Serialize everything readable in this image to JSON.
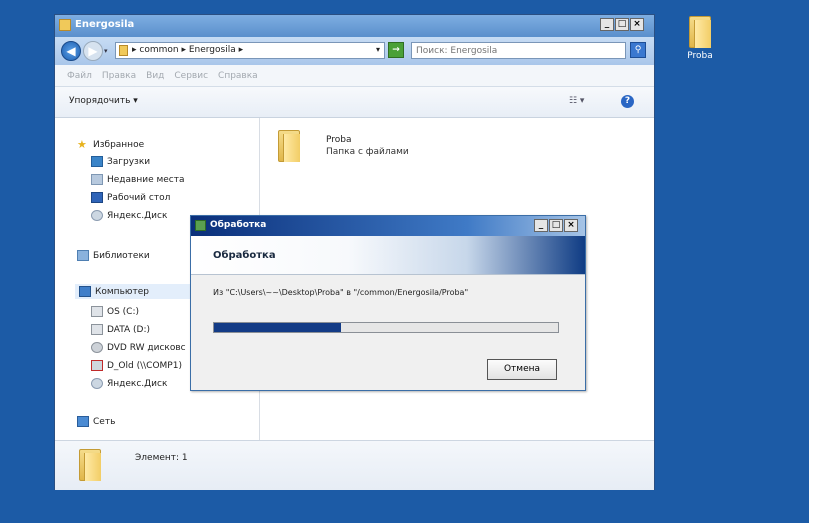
{
  "desktop": {
    "icon_label": "Proba",
    "colors": {
      "background": "#1c5ba6"
    }
  },
  "explorer": {
    "title": "Energosila",
    "window_buttons": {
      "minimize": "_",
      "maximize": "□",
      "close": "×"
    },
    "nav": {
      "back": "◀",
      "forward": "▶",
      "history": "▾"
    },
    "breadcrumb": "▸ common ▸ Energosila ▸",
    "address_dropdown": "▾",
    "refresh": "→",
    "search_placeholder": "Поиск: Energosila",
    "search_button": "⚲",
    "menu": [
      "Файл",
      "Правка",
      "Вид",
      "Сервис",
      "Справка"
    ],
    "toolbar": {
      "organize": "Упорядочить ▾",
      "view": "☷ ▾",
      "help": "?"
    },
    "sidebar": {
      "favorites": "Избранное",
      "fav_items": [
        "Загрузки",
        "Недавние места",
        "Рабочий стол",
        "Яндекс.Диск"
      ],
      "libraries": "Библиотеки",
      "computer": "Компьютер",
      "drives": [
        "OS (C:)",
        "DATA (D:)",
        "DVD RW дисковс",
        "D_Old (\\\\COMP1)",
        "Яндекс.Диск"
      ],
      "network": "Сеть"
    },
    "content": {
      "folder_name": "Proba",
      "folder_type": "Папка с файлами"
    },
    "details": "Элемент: 1"
  },
  "dialog": {
    "title": "Обработка",
    "header": "Обработка",
    "message": "Из \"C:\\Users\\~~\\Desktop\\Proba\" в \"/common/Energosila/Proba\"",
    "progress": 0.37,
    "cancel": "Отмена",
    "window_buttons": {
      "minimize": "_",
      "maximize": "□",
      "close": "×"
    }
  }
}
